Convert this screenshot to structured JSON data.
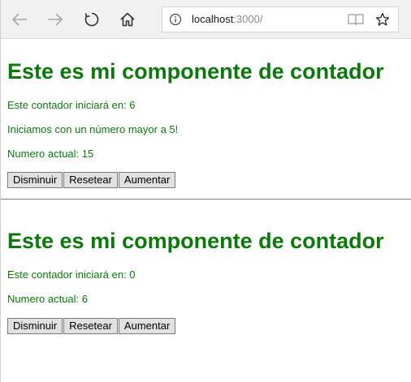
{
  "browser": {
    "url_host": "localhost",
    "url_path": ":3000/",
    "icons": {
      "back": "arrow-left-icon",
      "forward": "arrow-right-icon",
      "refresh": "refresh-icon",
      "home": "home-icon",
      "info": "info-icon",
      "reader": "reading-view-icon",
      "favorite": "star-icon"
    }
  },
  "counters": [
    {
      "title": "Este es mi componente de contador",
      "start_text": "Este contador iniciará en: 6",
      "extra_text": "Iniciamos con un número mayor a 5!",
      "current_text": "Numero actual: 15",
      "buttons": {
        "decrease": "Disminuir",
        "reset": "Resetear",
        "increase": "Aumentar"
      }
    },
    {
      "title": "Este es mi componente de contador",
      "start_text": "Este contador iniciará en: 0",
      "current_text": "Numero actual: 6",
      "buttons": {
        "decrease": "Disminuir",
        "reset": "Resetear",
        "increase": "Aumentar"
      }
    }
  ],
  "colors": {
    "text_green": "#0a7a0a",
    "toolbar_bg": "#f2f2f2",
    "button_bg": "#e1e1e1"
  }
}
